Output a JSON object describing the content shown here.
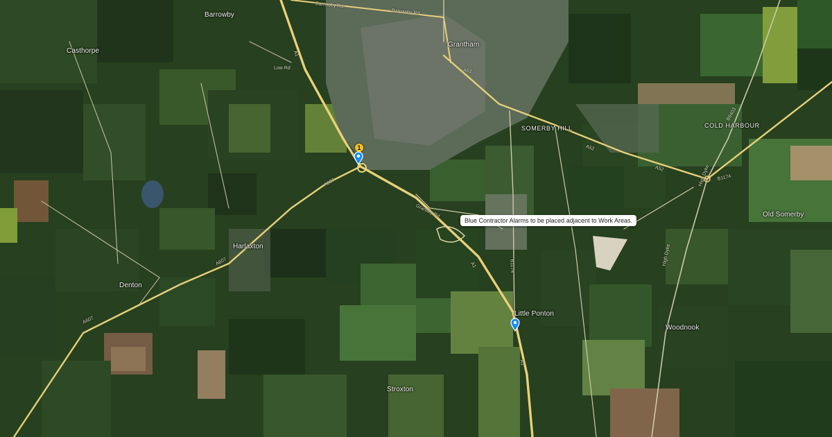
{
  "map": {
    "places": [
      {
        "id": "barrowby",
        "label": "Barrowby"
      },
      {
        "id": "castorpe",
        "label": "Casthorpe"
      },
      {
        "id": "grantham",
        "label": "Grantham"
      },
      {
        "id": "somerby-hill",
        "label": "SOMERBY HILL"
      },
      {
        "id": "cold-harbour",
        "label": "COLD HARBOUR"
      },
      {
        "id": "old-somerby",
        "label": "Old Somerby"
      },
      {
        "id": "harlaxton",
        "label": "Harlaxton"
      },
      {
        "id": "denton",
        "label": "Denton"
      },
      {
        "id": "little-ponton",
        "label": "Little Ponton"
      },
      {
        "id": "woodnook",
        "label": "Woodnook"
      },
      {
        "id": "stroxton",
        "label": "Stroxton"
      }
    ],
    "roads": [
      "Barrowby Rd",
      "Barrowby Rd",
      "A1",
      "A1",
      "A1",
      "A52",
      "A52",
      "A52",
      "A607",
      "A607",
      "A607",
      "B1174",
      "B1174",
      "Low Rd",
      "Grantley Rd",
      "High Dyke",
      "High Dyke",
      "B6403"
    ],
    "callout": "Blue Contractor Alarms to be placed adjacent to Work Areas.",
    "badge": "1",
    "marker_icons": [
      "map-pin-icon",
      "map-pin-icon"
    ],
    "colors": {
      "road_major": "#e8d07a",
      "road_minor": "#cfc8a8",
      "pin": "#1a8cff",
      "field_dark": "#24391f",
      "field_mid": "#3c5a2d"
    }
  }
}
